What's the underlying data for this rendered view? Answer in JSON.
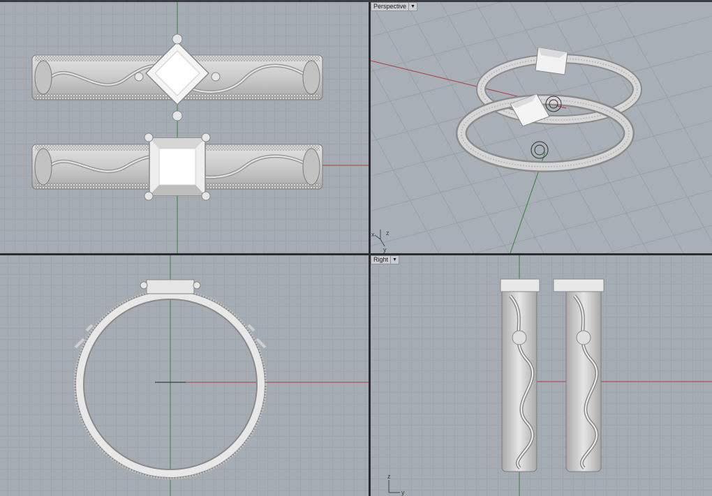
{
  "viewports": {
    "top": {
      "label": ""
    },
    "perspective": {
      "label": "Perspective"
    },
    "front": {
      "label": ""
    },
    "right": {
      "label": "Right"
    }
  },
  "axes": {
    "x": "x",
    "y": "y",
    "z": "z"
  },
  "colors": {
    "viewport_bg": "#a6acb3",
    "grid_minor": "#9aa0a7",
    "grid_major": "#8b9199",
    "x_axis": "#b03a3a",
    "y_axis": "#2f8a2f",
    "model_light": "#eeeeee",
    "model_mid": "#cfcfcf",
    "model_dark": "#8c8c8c"
  },
  "icons": {
    "dropdown": "chevron-down-icon"
  }
}
